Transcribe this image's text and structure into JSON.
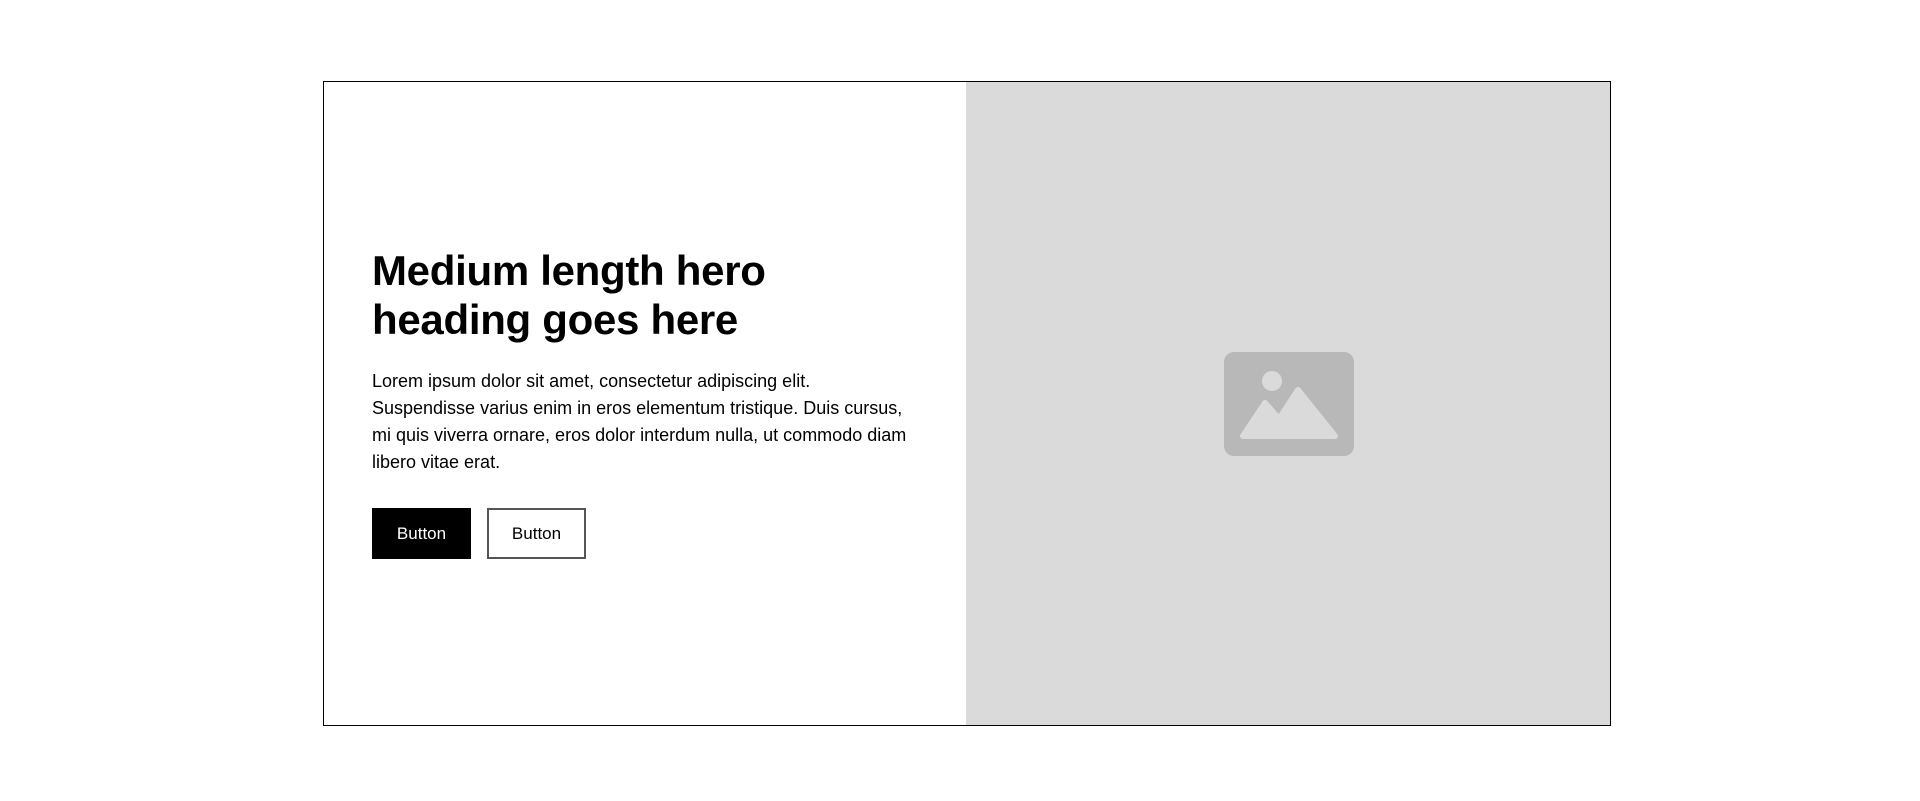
{
  "hero": {
    "heading": "Medium length hero heading goes here",
    "body": "Lorem ipsum dolor sit amet, consectetur adipiscing elit. Suspendisse varius enim in eros elementum tristique. Duis cursus, mi quis viverra ornare, eros dolor interdum nulla, ut commodo diam libero vitae erat.",
    "primary_button_label": "Button",
    "secondary_button_label": "Button"
  },
  "media": {
    "icon": "image-placeholder-icon",
    "background_color": "#dadada",
    "icon_color": "#b8b8b8"
  }
}
